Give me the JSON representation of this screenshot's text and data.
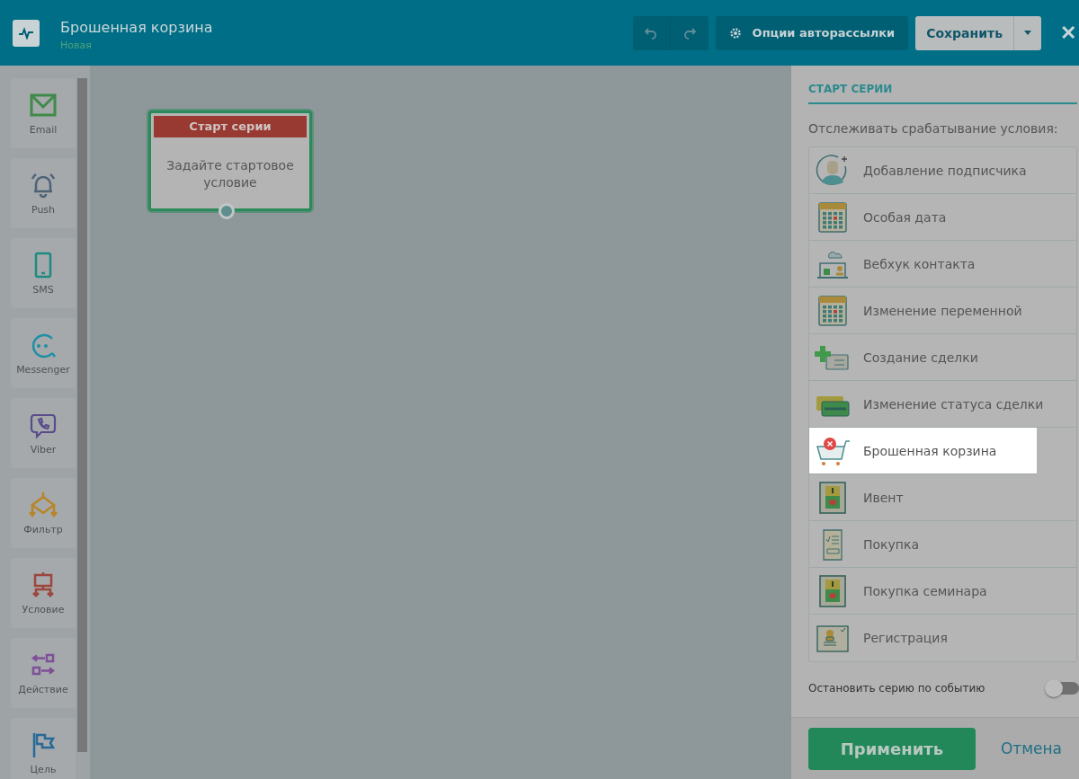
{
  "header": {
    "title": "Брошенная корзина",
    "subtitle": "Новая",
    "options_button": "Опции авторассылки",
    "save_button": "Сохранить",
    "close": "✕"
  },
  "sidebar": {
    "items": [
      {
        "kind": "email",
        "label": "Email"
      },
      {
        "kind": "push",
        "label": "Push"
      },
      {
        "kind": "sms",
        "label": "SMS"
      },
      {
        "kind": "messenger",
        "label": "Messenger"
      },
      {
        "kind": "viber",
        "label": "Viber"
      },
      {
        "kind": "filter",
        "label": "Фильтр"
      },
      {
        "kind": "condition",
        "label": "Условие"
      },
      {
        "kind": "action",
        "label": "Действие"
      },
      {
        "kind": "goal",
        "label": "Цель"
      }
    ]
  },
  "canvas": {
    "node": {
      "title": "Старт серии",
      "text": "Задайте стартовое условие"
    }
  },
  "panel": {
    "heading": "СТАРТ СЕРИИ",
    "prompt": "Отслеживать срабатывание условия:",
    "triggers": [
      {
        "kind": "person",
        "label": "Добавление подписчика",
        "selected": false
      },
      {
        "kind": "calendar",
        "label": "Особая дата",
        "selected": false
      },
      {
        "kind": "webhook",
        "label": "Вебхук контакта",
        "selected": false
      },
      {
        "kind": "calendar",
        "label": "Изменение переменной",
        "selected": false
      },
      {
        "kind": "deal-add",
        "label": "Создание сделки",
        "selected": false
      },
      {
        "kind": "deal-status",
        "label": "Изменение статуса сделки",
        "selected": false
      },
      {
        "kind": "cart",
        "label": "Брошенная корзина",
        "selected": true
      },
      {
        "kind": "event",
        "label": "Ивент",
        "selected": false
      },
      {
        "kind": "receipt",
        "label": "Покупка",
        "selected": false
      },
      {
        "kind": "event",
        "label": "Покупка семинара",
        "selected": false
      },
      {
        "kind": "registration",
        "label": "Регистрация",
        "selected": false
      }
    ],
    "stop_toggle": {
      "label": "Остановить серию по событию",
      "on": false
    },
    "apply_button": "Применить",
    "cancel_link": "Отмена"
  }
}
